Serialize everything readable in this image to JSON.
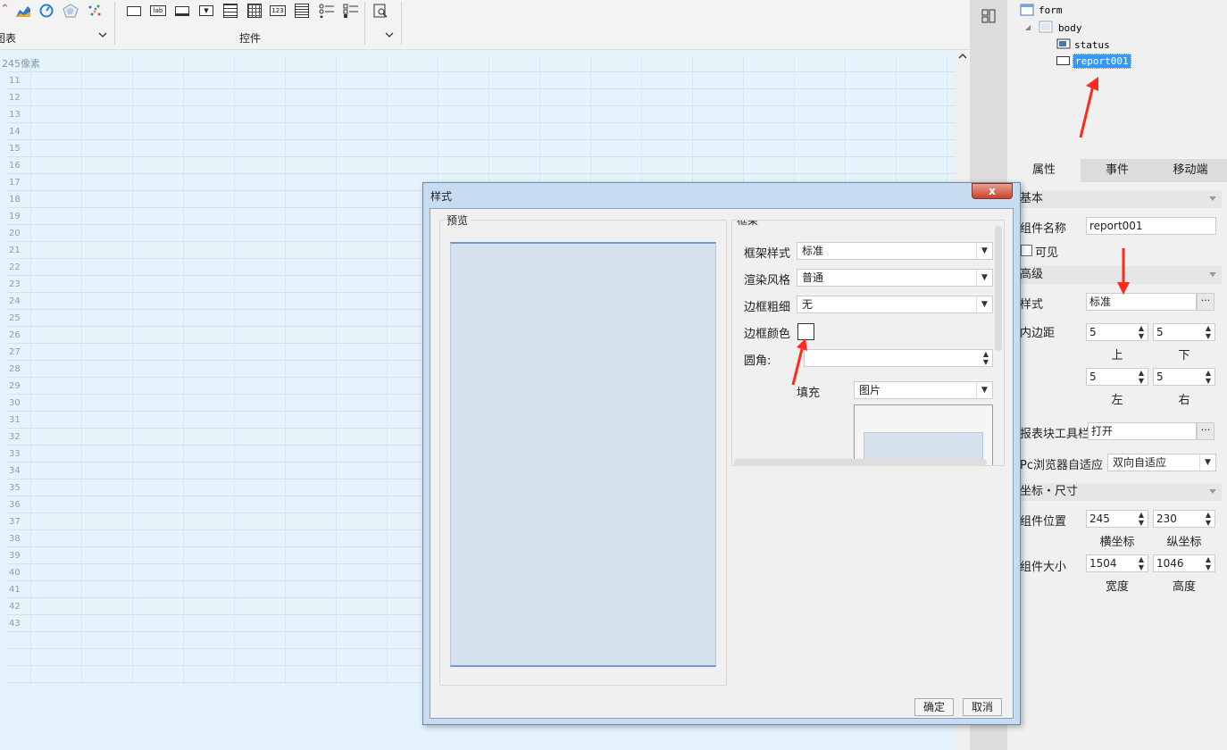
{
  "toolbar": {
    "chart_group_label": "图表",
    "controls_group_label": "控件",
    "icons": [
      "area-chart-icon",
      "gauge-chart-icon",
      "radar-chart-icon",
      "scatter-chart-icon",
      "frame-control-icon",
      "label-control-icon",
      "text-control-icon",
      "dropdown-control-icon",
      "checkbox-list-icon",
      "date-control-icon",
      "number-control-icon",
      "textarea-control-icon",
      "radio-group-icon",
      "checkbox-group-icon",
      "query-icon"
    ]
  },
  "canvas": {
    "pixel_label": "245像素",
    "row_numbers": [
      "11",
      "12",
      "13",
      "14",
      "15",
      "16",
      "17",
      "18",
      "19",
      "20",
      "21",
      "22",
      "23",
      "24",
      "25",
      "26",
      "27",
      "28",
      "29",
      "30",
      "31",
      "32",
      "33",
      "34",
      "35",
      "36",
      "37",
      "38",
      "39",
      "40",
      "41",
      "42",
      "43"
    ]
  },
  "tree": {
    "root": "form",
    "body": "body",
    "status": "status",
    "report": "report001"
  },
  "tabs": [
    "属性",
    "事件",
    "移动端"
  ],
  "props": {
    "basic_section": "基本",
    "component_name_label": "组件名称",
    "component_name_value": "report001",
    "visible_label": "可见",
    "advanced_section": "高级",
    "style_label": "样式",
    "style_value": "标准",
    "padding_label": "内边距",
    "padding_top": "5",
    "padding_bottom": "5",
    "padding_left": "5",
    "padding_right": "5",
    "top_label": "上",
    "bottom_label": "下",
    "left_label": "左",
    "right_label": "右",
    "toolbar_label": "报表块工具栏",
    "toolbar_value": "打开",
    "pc_adapt_label": "Pc浏览器自适应",
    "pc_adapt_value": "双向自适应",
    "coord_section": "坐标・尺寸",
    "position_label": "组件位置",
    "pos_x": "245",
    "pos_y": "230",
    "x_label": "横坐标",
    "y_label": "纵坐标",
    "size_label": "组件大小",
    "width_value": "1504",
    "height_value": "1046",
    "width_label": "宽度",
    "height_label": "高度"
  },
  "dialog": {
    "title": "样式",
    "close": "x",
    "preview_legend": "预览",
    "frame_legend": "框架",
    "frame_style_label": "框架样式",
    "frame_style_value": "标准",
    "render_style_label": "渲染风格",
    "render_style_value": "普通",
    "border_width_label": "边框粗细",
    "border_width_value": "无",
    "border_color_label": "边框颜色",
    "radius_label": "圆角:",
    "fill_label": "填充",
    "fill_value": "图片",
    "ok": "确定",
    "cancel": "取消"
  },
  "colors": {
    "selection": "#3399ff",
    "arrow": "#ff2a1a",
    "canvas": "#e4f2fb",
    "preview": "#d6e1ee"
  }
}
